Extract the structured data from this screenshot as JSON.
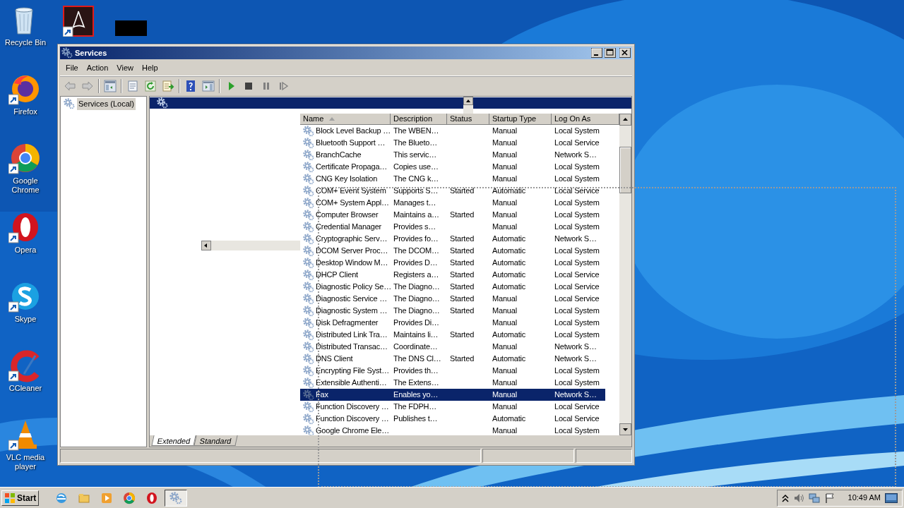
{
  "desktop_icons": [
    {
      "label": "Recycle Bin",
      "kind": "bin"
    },
    {
      "label": "Firefox",
      "kind": "firefox"
    },
    {
      "label": "Google Chrome",
      "kind": "chrome"
    },
    {
      "label": "Opera",
      "kind": "opera"
    },
    {
      "label": "Skype",
      "kind": "skype"
    },
    {
      "label": "CCleaner",
      "kind": "ccleaner"
    },
    {
      "label": "VLC media player",
      "kind": "vlc"
    }
  ],
  "window": {
    "title": "Services"
  },
  "menu": [
    "File",
    "Action",
    "View",
    "Help"
  ],
  "tree": {
    "items": [
      {
        "label": "Services (Local)",
        "selected": true
      }
    ]
  },
  "table": {
    "columns": [
      "Name",
      "Description",
      "Status",
      "Startup Type",
      "Log On As"
    ],
    "rows": [
      {
        "name": "Block Level Backup …",
        "description": "The WBEN…",
        "startup_type": "Manual",
        "log_on_as": "Local System",
        "selected": false
      },
      {
        "name": "Bluetooth Support …",
        "description": "The Blueto…",
        "startup_type": "Manual",
        "log_on_as": "Local Service",
        "selected": false
      },
      {
        "name": "BranchCache",
        "description": "This servic…",
        "startup_type": "Manual",
        "log_on_as": "Network S…",
        "selected": false
      },
      {
        "name": "Certificate Propaga…",
        "description": "Copies use…",
        "startup_type": "Manual",
        "log_on_as": "Local System",
        "selected": false
      },
      {
        "name": "CNG Key Isolation",
        "description": "The CNG k…",
        "startup_type": "Manual",
        "log_on_as": "Local System",
        "selected": false
      },
      {
        "name": "COM+ Event System",
        "description": "Supports S…",
        "status": "Started",
        "startup_type": "Automatic",
        "log_on_as": "Local Service",
        "selected": false
      },
      {
        "name": "COM+ System Appl…",
        "description": "Manages t…",
        "startup_type": "Manual",
        "log_on_as": "Local System",
        "selected": false
      },
      {
        "name": "Computer Browser",
        "description": "Maintains a…",
        "status": "Started",
        "startup_type": "Manual",
        "log_on_as": "Local System",
        "selected": false
      },
      {
        "name": "Credential Manager",
        "description": "Provides s…",
        "startup_type": "Manual",
        "log_on_as": "Local System",
        "selected": false
      },
      {
        "name": "Cryptographic Serv…",
        "description": "Provides fo…",
        "status": "Started",
        "startup_type": "Automatic",
        "log_on_as": "Network S…",
        "selected": false
      },
      {
        "name": "DCOM Server Proc…",
        "description": "The DCOM…",
        "status": "Started",
        "startup_type": "Automatic",
        "log_on_as": "Local System",
        "selected": false
      },
      {
        "name": "Desktop Window M…",
        "description": "Provides D…",
        "status": "Started",
        "startup_type": "Automatic",
        "log_on_as": "Local System",
        "selected": false
      },
      {
        "name": "DHCP Client",
        "description": "Registers a…",
        "status": "Started",
        "startup_type": "Automatic",
        "log_on_as": "Local Service",
        "selected": false
      },
      {
        "name": "Diagnostic Policy Se…",
        "description": "The Diagno…",
        "status": "Started",
        "startup_type": "Automatic",
        "log_on_as": "Local Service",
        "selected": false
      },
      {
        "name": "Diagnostic Service …",
        "description": "The Diagno…",
        "status": "Started",
        "startup_type": "Manual",
        "log_on_as": "Local Service",
        "selected": false
      },
      {
        "name": "Diagnostic System …",
        "description": "The Diagno…",
        "status": "Started",
        "startup_type": "Manual",
        "log_on_as": "Local System",
        "selected": false
      },
      {
        "name": "Disk Defragmenter",
        "description": "Provides Di…",
        "startup_type": "Manual",
        "log_on_as": "Local System",
        "selected": false
      },
      {
        "name": "Distributed Link Tra…",
        "description": "Maintains li…",
        "status": "Started",
        "startup_type": "Automatic",
        "log_on_as": "Local System",
        "selected": false
      },
      {
        "name": "Distributed Transac…",
        "description": "Coordinate…",
        "startup_type": "Manual",
        "log_on_as": "Network S…",
        "selected": false
      },
      {
        "name": "DNS Client",
        "description": "The DNS Cl…",
        "status": "Started",
        "startup_type": "Automatic",
        "log_on_as": "Network S…",
        "selected": false
      },
      {
        "name": "Encrypting File Syst…",
        "description": "Provides th…",
        "startup_type": "Manual",
        "log_on_as": "Local System",
        "selected": false
      },
      {
        "name": "Extensible Authenti…",
        "description": "The Extens…",
        "startup_type": "Manual",
        "log_on_as": "Local System",
        "selected": false
      },
      {
        "name": "Fax",
        "description": "Enables yo…",
        "startup_type": "Manual",
        "log_on_as": "Network S…",
        "selected": true
      },
      {
        "name": "Function Discovery …",
        "description": "The FDPH…",
        "startup_type": "Manual",
        "log_on_as": "Local Service",
        "selected": false
      },
      {
        "name": "Function Discovery …",
        "description": "Publishes t…",
        "startup_type": "Automatic",
        "log_on_as": "Local Service",
        "selected": false
      },
      {
        "name": "Google Chrome Ele…",
        "startup_type": "Manual",
        "log_on_as": "Local System",
        "selected": false
      }
    ]
  },
  "view_tabs": [
    {
      "label": "Extended",
      "selected": true
    },
    {
      "label": "Standard",
      "selected": false
    }
  ],
  "taskbar": {
    "start": "Start",
    "apps": [
      {
        "kind": "ie",
        "selected": false
      },
      {
        "kind": "explorer",
        "selected": false
      },
      {
        "kind": "media",
        "selected": false
      },
      {
        "kind": "chrome",
        "selected": false
      },
      {
        "kind": "opera",
        "selected": false
      },
      {
        "kind": "services",
        "selected": true
      }
    ],
    "clock": "10:49 AM"
  }
}
